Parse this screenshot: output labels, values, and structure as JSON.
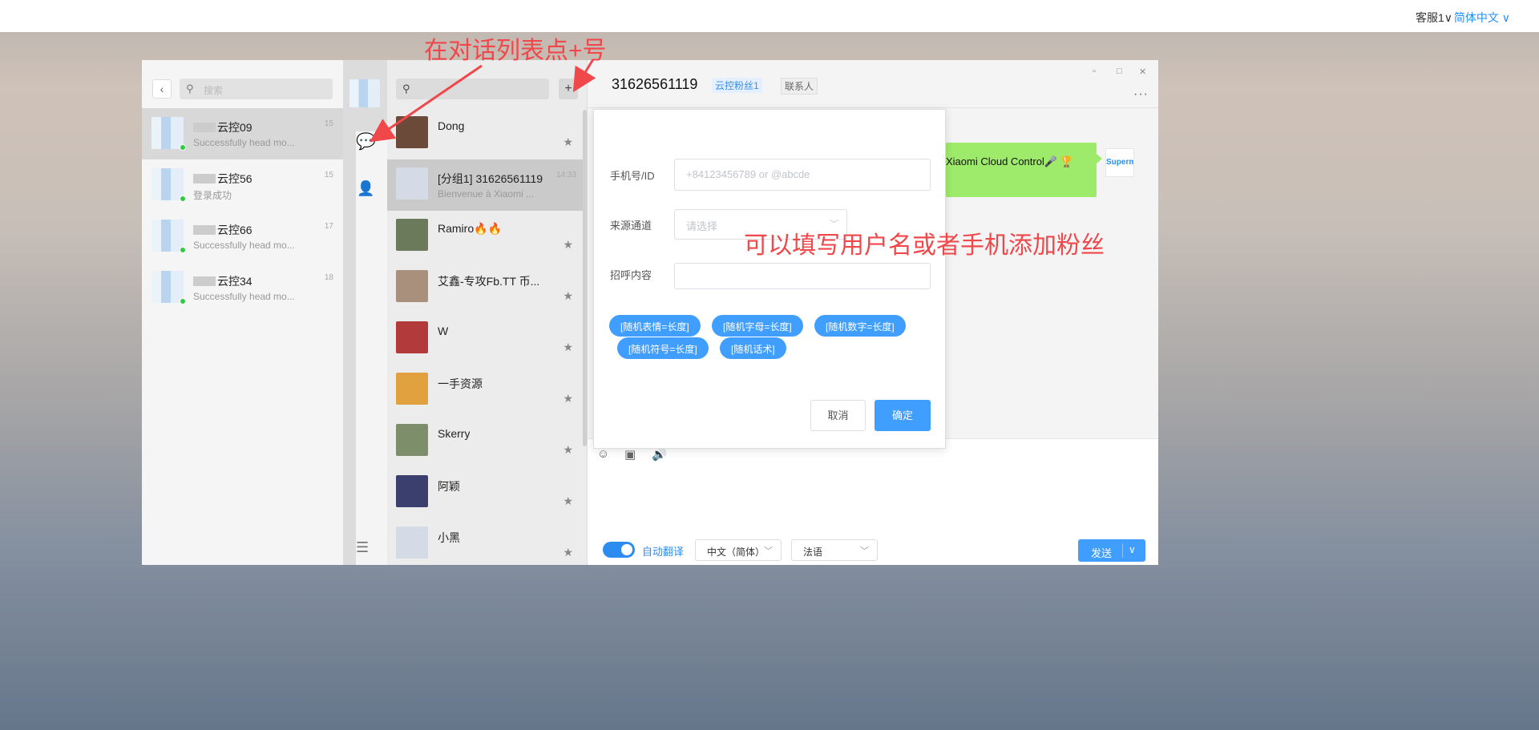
{
  "topbar": {
    "account": "客服1",
    "account_chev": "∨",
    "language": "简体中文",
    "language_chev": "∨"
  },
  "accounts_panel": {
    "search_placeholder": "搜索",
    "items": [
      {
        "name": "云控09",
        "preview": "Successfully head mo...",
        "time": "15",
        "online": true,
        "active": true
      },
      {
        "name": "云控56",
        "preview": "登录成功",
        "time": "15",
        "online": true,
        "active": false
      },
      {
        "name": "云控66",
        "preview": "Successfully head mo...",
        "time": "17",
        "online": true,
        "active": false
      },
      {
        "name": "云控34",
        "preview": "Successfully head mo...",
        "time": "18",
        "online": true,
        "active": false
      }
    ]
  },
  "conversations": {
    "add_label": "+",
    "items": [
      {
        "name": "Dong",
        "preview": "",
        "time": "",
        "avatar_color": "#6b4a3a",
        "active": false
      },
      {
        "name": "[分组1] 31626561119",
        "preview": "Bienvenue à Xiaomi ...",
        "time": "14:33",
        "avatar_color": "#d5dbe6",
        "active": true
      },
      {
        "name": "Ramiro🔥🔥",
        "preview": "",
        "time": "",
        "avatar_color": "#6b7a5a",
        "active": false
      },
      {
        "name": "艾鑫-专攻Fb.TT 币...",
        "preview": "",
        "time": "",
        "avatar_color": "#a8907c",
        "active": false
      },
      {
        "name": "W",
        "preview": "",
        "time": "",
        "avatar_color": "#b33a3a",
        "active": false
      },
      {
        "name": "一手资源",
        "preview": "",
        "time": "",
        "avatar_color": "#e0a13e",
        "active": false
      },
      {
        "name": "Skerry",
        "preview": "",
        "time": "",
        "avatar_color": "#7d8f6a",
        "active": false
      },
      {
        "name": "阿颖",
        "preview": "",
        "time": "",
        "avatar_color": "#3b3f6e",
        "active": false
      },
      {
        "name": "小黑",
        "preview": "",
        "time": "",
        "avatar_color": "#d5dbe6",
        "active": false
      }
    ]
  },
  "chat": {
    "title": "31626561119",
    "tag_fan": "云控粉丝1",
    "tag_contact": "联系人",
    "more": "···",
    "message_text": "Xiaomi Cloud Control🎤 🏆",
    "sender_logo": "Superm",
    "auto_translate_label": "自动翻译",
    "source_lang": "中文（简体）",
    "target_lang": "法语",
    "send_label": "发送"
  },
  "dialog": {
    "phone_label": "手机号/ID",
    "phone_placeholder": "+84123456789 or @abcde",
    "source_label": "来源通道",
    "source_placeholder": "请选择",
    "greeting_label": "招呼内容",
    "chips": [
      "[随机表情=长度]",
      "[随机字母=长度]",
      "[随机数字=长度]",
      "[随机符号=长度]",
      "[随机话术]"
    ],
    "cancel_label": "取消",
    "ok_label": "确定"
  },
  "annotations": {
    "top": "在对话列表点+号",
    "middle": "可以填写用户名或者手机添加粉丝"
  },
  "colors": {
    "accent": "#409eff",
    "annotation": "#f0474a",
    "bubble": "#9eea6a"
  }
}
